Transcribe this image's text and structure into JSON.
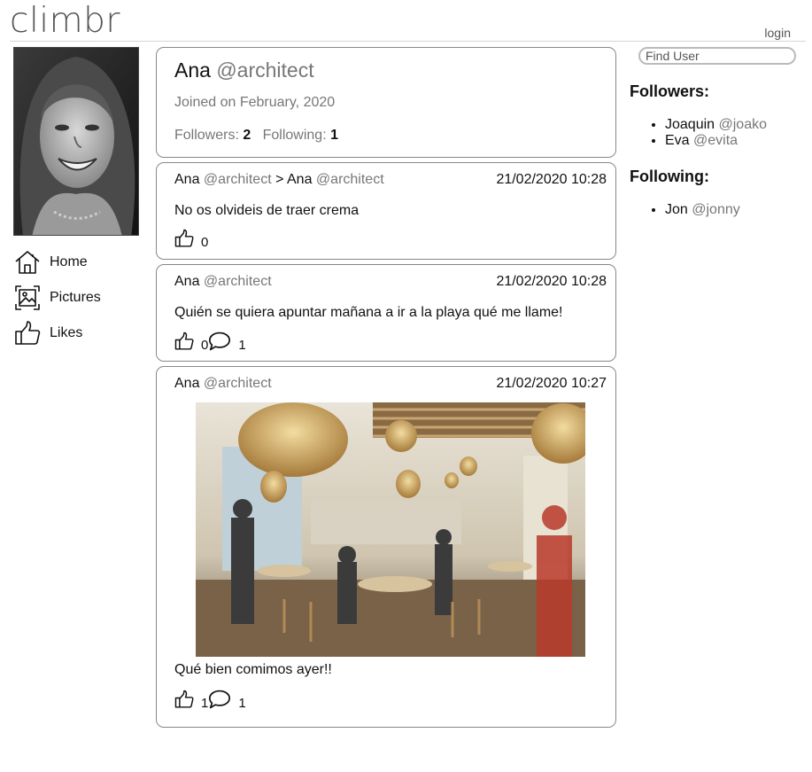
{
  "header": {
    "brand": "climbr",
    "login": "login"
  },
  "nav": [
    {
      "label": "Home",
      "icon": "home-icon"
    },
    {
      "label": "Pictures",
      "icon": "pictures-icon"
    },
    {
      "label": "Likes",
      "icon": "likes-icon"
    }
  ],
  "profile": {
    "name": "Ana",
    "handle": "@architect",
    "joined": "Joined on February, 2020",
    "followers_label": "Followers:",
    "followers_count": "2",
    "following_label": "Following:",
    "following_count": "1"
  },
  "posts": [
    {
      "author": "Ana",
      "handle": "@architect",
      "reply_sep": ">",
      "to_author": "Ana",
      "to_handle": "@architect",
      "date": "21/02/2020 10:28",
      "text": "No os olvideis de traer crema",
      "likes": "0"
    },
    {
      "author": "Ana",
      "handle": "@architect",
      "date": "21/02/2020 10:28",
      "text": "Quién se quiera apuntar mañana a ir a la playa qué me llame!",
      "likes": "0",
      "comments": "1"
    },
    {
      "author": "Ana",
      "handle": "@architect",
      "date": "21/02/2020 10:27",
      "text": "Qué bien comimos ayer!!",
      "likes": "1",
      "comments": "1"
    }
  ],
  "search": {
    "placeholder": "Find User"
  },
  "followers": {
    "title": "Followers:",
    "items": [
      {
        "name": "Joaquin",
        "handle": "@joako"
      },
      {
        "name": "Eva",
        "handle": "@evita"
      }
    ]
  },
  "following": {
    "title": "Following:",
    "items": [
      {
        "name": "Jon",
        "handle": "@jonny"
      }
    ]
  }
}
